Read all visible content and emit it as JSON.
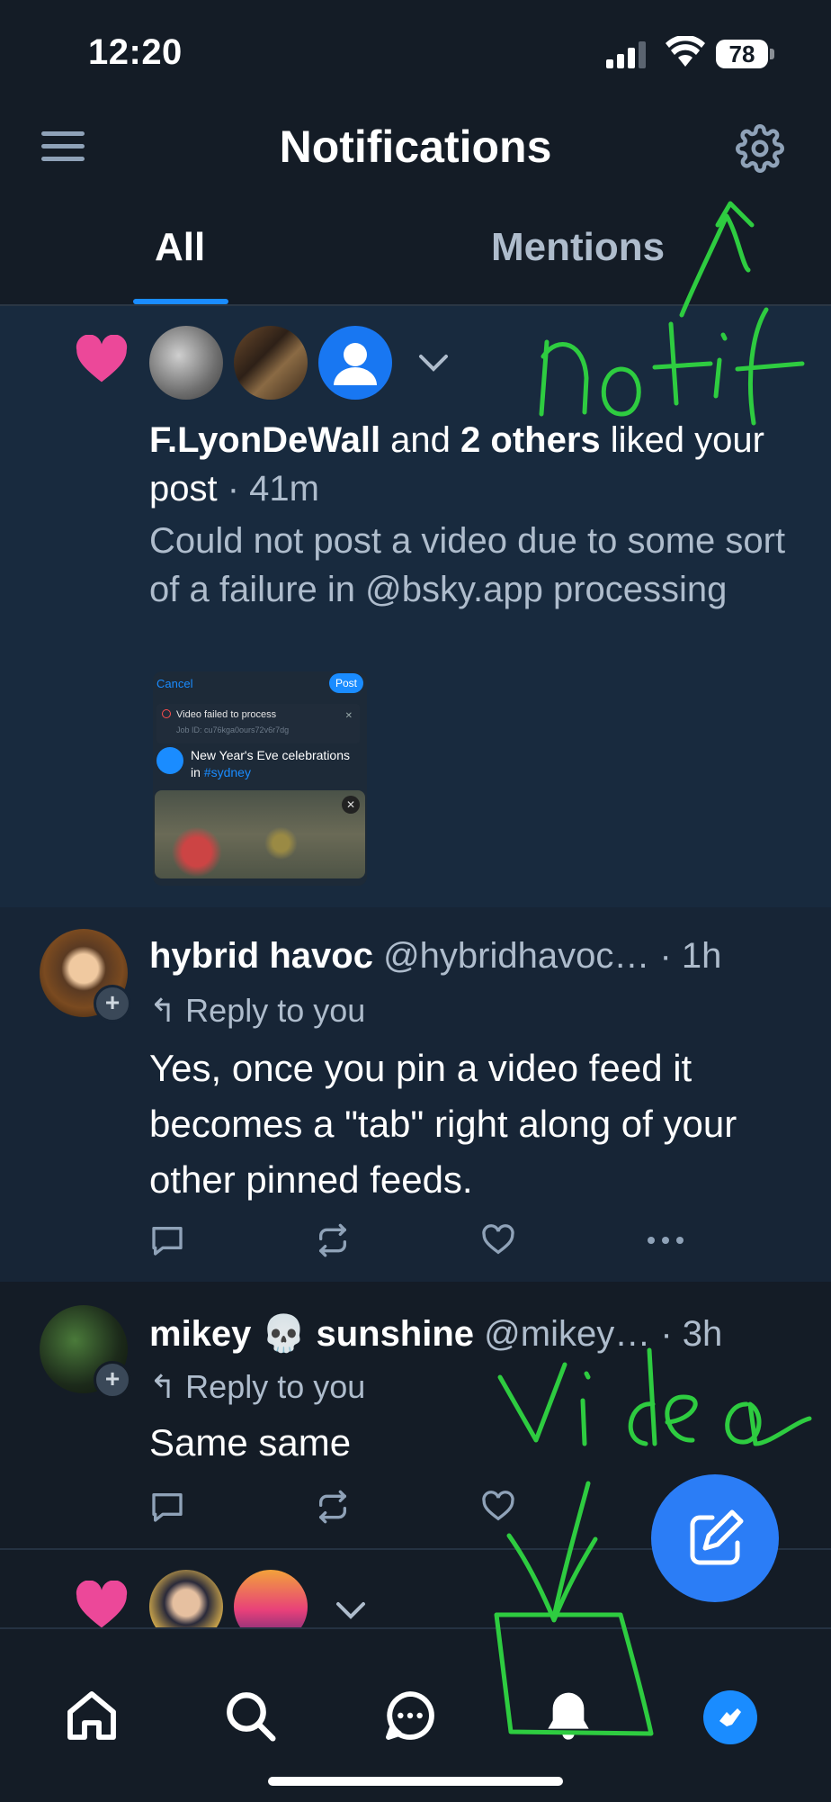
{
  "status_bar": {
    "time": "12:20",
    "battery": "78"
  },
  "header": {
    "title": "Notifications"
  },
  "tabs": [
    {
      "label": "All"
    },
    {
      "label": "Mentions"
    }
  ],
  "liked_notification": {
    "actor": "F.LyonDeWall",
    "connector": " and ",
    "others": "2 others",
    "action": " liked your post",
    "time": " · 41m",
    "excerpt": "Could not post a video due to some sort of a failure in @bsky.app processing",
    "embed": {
      "cancel": "Cancel",
      "post": "Post",
      "error_title": "Video failed to process",
      "job_id": "Job ID: cu76kga0ours72v6r7dg",
      "caption": "New Year's Eve celebrations in ",
      "hashtag": "#sydney"
    }
  },
  "replies": [
    {
      "name": "hybrid havoc",
      "handle": " @hybridhavoc…",
      "time": " · 1h",
      "reply_to": "Reply to you",
      "body": "Yes, once you pin a video feed it becomes a \"tab\" right along of your other pinned feeds."
    },
    {
      "name": "mikey 💀 sunshine",
      "handle": " @mikey…",
      "time": " · 3h",
      "reply_to": "Reply to you",
      "body": "Same same"
    }
  ],
  "annotations": {
    "top": "notif",
    "bottom": "Video"
  },
  "colors": {
    "accent": "#1a8cff",
    "heart": "#ec4899",
    "background": "#141c26",
    "annotation": "#2ecc40"
  }
}
